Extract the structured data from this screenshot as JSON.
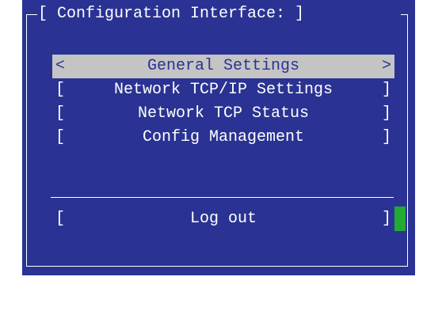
{
  "window": {
    "title": "[ Configuration Interface: ]"
  },
  "menu": {
    "items": [
      {
        "left": "<",
        "label": "General Settings",
        "right": ">",
        "selected": true
      },
      {
        "left": "[",
        "label": "Network TCP/IP Settings",
        "right": "]",
        "selected": false
      },
      {
        "left": "[",
        "label": "Network TCP Status",
        "right": "]",
        "selected": false
      },
      {
        "left": "[",
        "label": "Config Management",
        "right": "]",
        "selected": false
      }
    ]
  },
  "footer": {
    "logout": {
      "left": "[",
      "label": "Log out",
      "right": "]"
    }
  },
  "colors": {
    "background": "#2a3393",
    "highlight": "#c4c4c4",
    "cursor": "#22aa33",
    "text": "#ffffff"
  }
}
